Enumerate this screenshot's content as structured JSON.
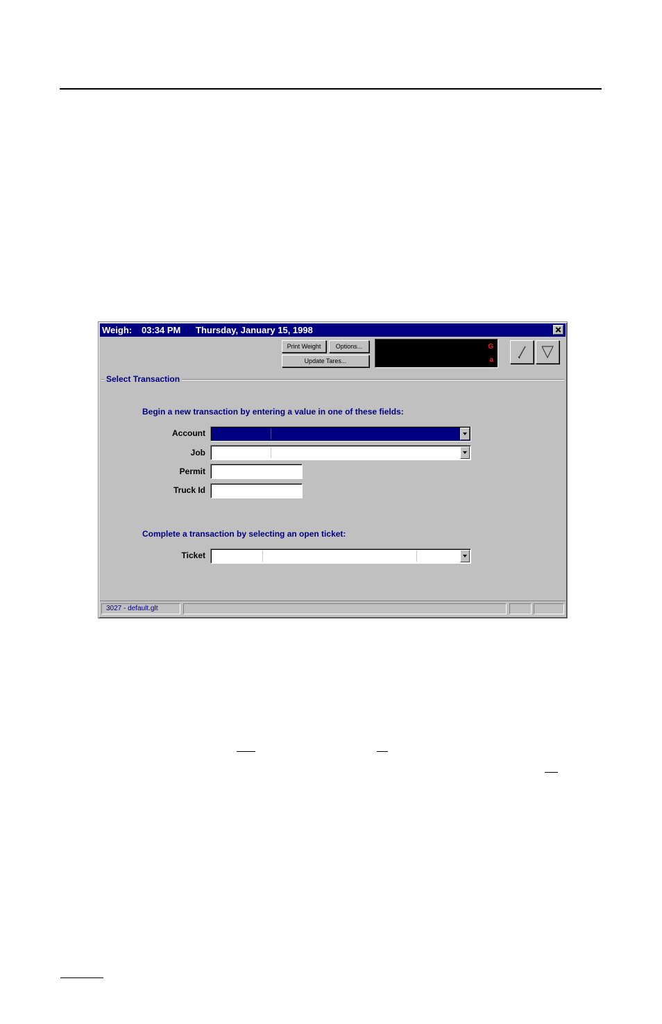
{
  "window": {
    "title_app": "Weigh:",
    "title_time": "03:34 PM",
    "title_date": "Thursday, January 15, 1998"
  },
  "toolbar": {
    "buttons": [
      {
        "label": "Print Weight"
      },
      {
        "label": "Options..."
      },
      {
        "label": "Update Tares..."
      }
    ]
  },
  "scale_display": {
    "indicators": [
      "G",
      "a"
    ]
  },
  "group": {
    "label": "Select Transaction"
  },
  "new_transaction": {
    "instruction": "Begin a new transaction by entering a value in one of these fields:",
    "fields": [
      {
        "label": "Account",
        "value": ""
      },
      {
        "label": "Job",
        "value": ""
      },
      {
        "label": "Permit",
        "value": ""
      },
      {
        "label": "Truck Id",
        "value": ""
      }
    ]
  },
  "complete_transaction": {
    "instruction": "Complete a transaction by selecting an open ticket:",
    "ticket_label": "Ticket",
    "ticket_value": ""
  },
  "status_bar": {
    "pane_main": "3027 - default.glt"
  },
  "colors": {
    "title_bar": "#000080",
    "face": "#c0c0c0",
    "selection": "#000080",
    "display_bg": "#000000",
    "display_text": "#ff2020"
  }
}
